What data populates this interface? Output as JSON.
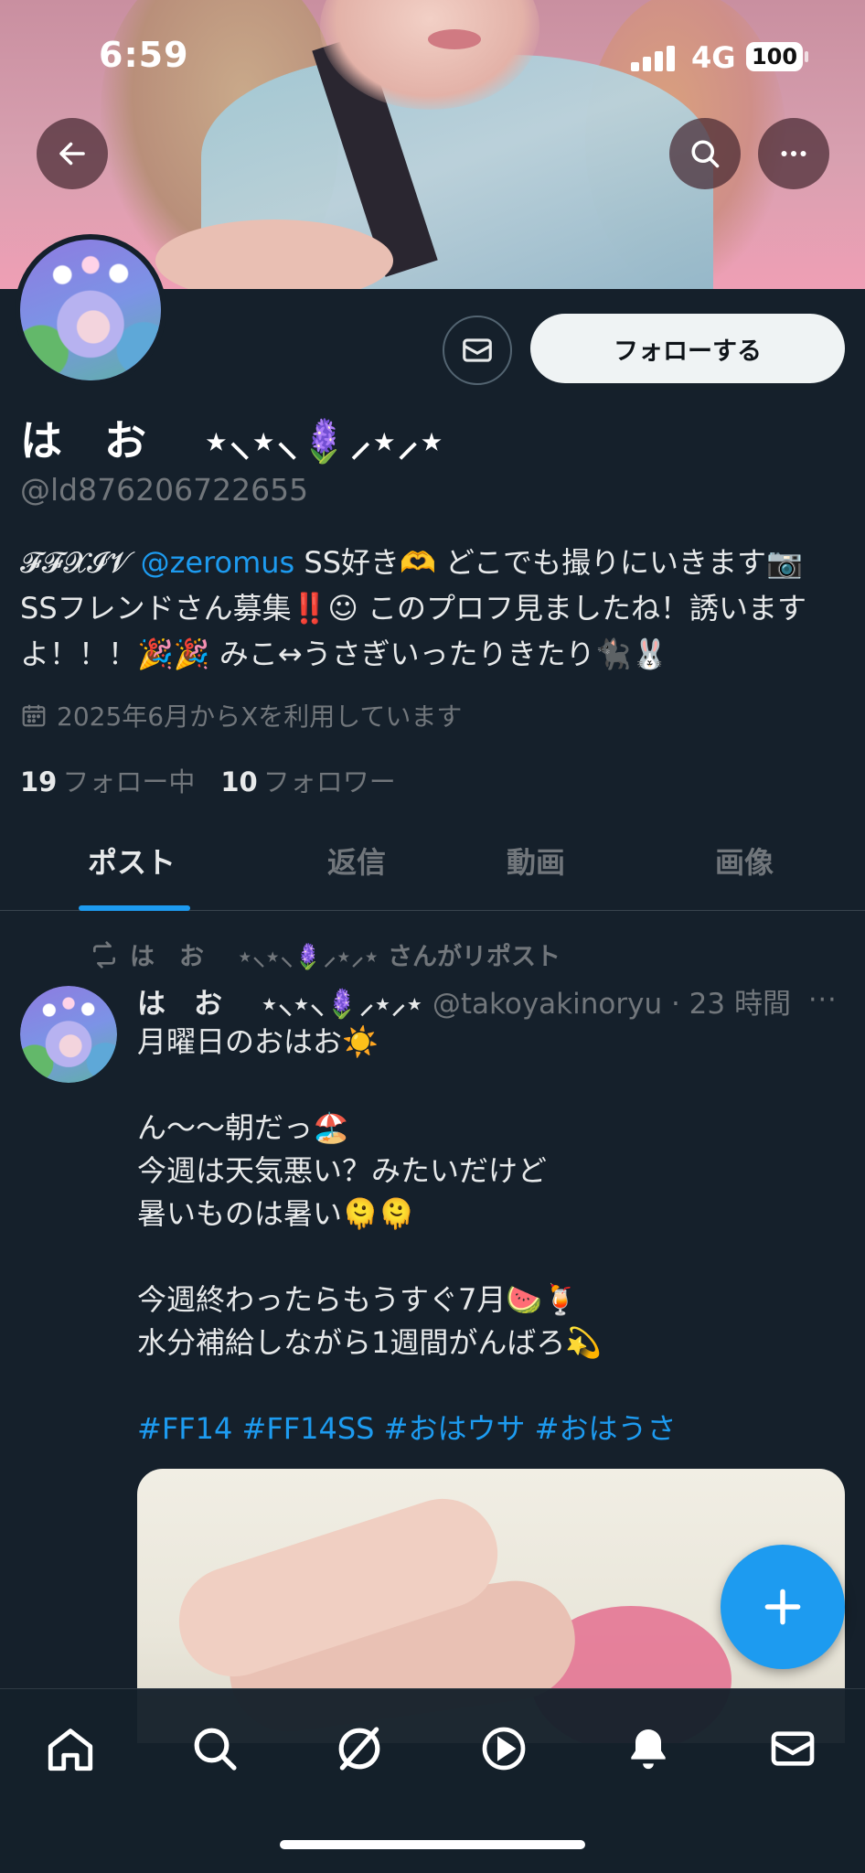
{
  "status_bar": {
    "time": "6:59",
    "network": "4G",
    "battery": "100"
  },
  "profile": {
    "name": "は　お　 ⋆⸜⋆⸜🪻⸝⋆⸝⋆",
    "handle": "@ld876206722655",
    "follow_label": "フォローする",
    "bio_prefix": "𝓕𝓕𝓧𝓘𝓥 ",
    "bio_mention": "@zeromus",
    "bio_rest": " SS好き🫶 どこでも撮りにいきます📷 SSフレンドさん募集‼️☺︎ このプロフ見ましたね！誘いますよ！！！🎉🎉 みこ↔︎うさぎいったりきたり🐈‍⬛🐰",
    "joined": "2025年6月からXを利用しています",
    "following_count": "19",
    "following_label": "フォロー中",
    "followers_count": "10",
    "followers_label": "フォロワー"
  },
  "tabs": [
    {
      "label": "ポスト",
      "active": true
    },
    {
      "label": "返信",
      "active": false
    },
    {
      "label": "動画",
      "active": false
    },
    {
      "label": "画像",
      "active": false
    }
  ],
  "post": {
    "repost_label": "は　お　 ⋆⸜⋆⸜🪻⸝⋆⸝⋆ さんがリポスト",
    "author_name": "は　お　 ⋆⸜⋆⸜🪻⸝⋆⸝⋆",
    "author_handle": "@takoyakinoryu",
    "time": "· 23 時間",
    "more": "···",
    "lines": [
      "月曜日のおはお☀️",
      "",
      "ん〜〜朝だっ🏖️",
      "今週は天気悪い？みたいだけど",
      "暑いものは暑い🫠🫠",
      "",
      "今週終わったらもうすぐ7月🍉🍹",
      "水分補給しながら1週間がんばろ💫",
      ""
    ],
    "hashtags": "#FF14 #FF14SS #おはウサ #おはうさ"
  },
  "icons": {
    "back": "back-arrow-icon",
    "search": "search-icon",
    "more": "more-icon",
    "mail": "mail-icon",
    "calendar": "calendar-icon",
    "repost": "repost-icon",
    "compose": "plus-icon",
    "nav": [
      "home-icon",
      "search-icon",
      "grok-icon",
      "video-icon",
      "bell-icon",
      "mail-icon"
    ]
  },
  "colors": {
    "accent": "#1d9bf0",
    "background": "#15202b",
    "muted": "#71767b"
  }
}
